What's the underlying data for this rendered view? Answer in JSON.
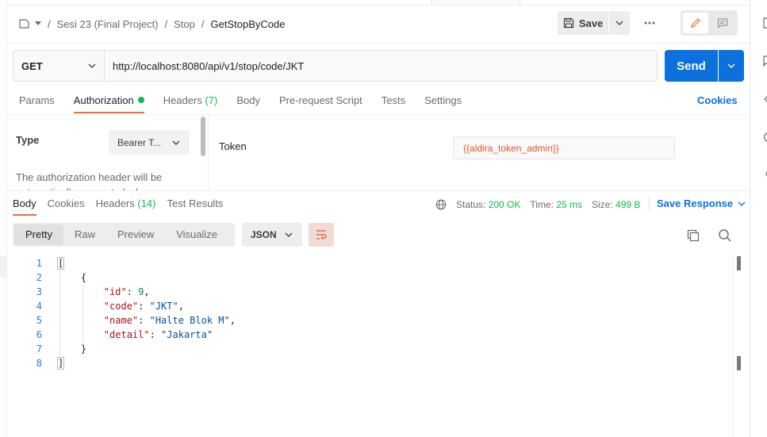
{
  "breadcrumb": {
    "items": [
      "Sesi 23 (Final Project)",
      "Stop"
    ],
    "separator": "/",
    "current": "GetStopByCode"
  },
  "toolbar": {
    "save_label": "Save"
  },
  "request": {
    "method": "GET",
    "url": "http://localhost:8080/api/v1/stop/code/JKT",
    "send_label": "Send"
  },
  "request_tabs": {
    "params": "Params",
    "authorization": "Authorization",
    "headers": "Headers",
    "headers_count": "(7)",
    "body": "Body",
    "pre_request": "Pre-request Script",
    "tests": "Tests",
    "settings": "Settings",
    "cookies": "Cookies"
  },
  "auth": {
    "type_label": "Type",
    "type_value": "Bearer T...",
    "description": "The authorization header will be automatically generated when you",
    "token_label": "Token",
    "token_value": "{{aldira_token_admin}}"
  },
  "response_tabs": {
    "body": "Body",
    "cookies": "Cookies",
    "headers": "Headers",
    "headers_count": "(14)",
    "test_results": "Test Results"
  },
  "response_status": {
    "status_label": "Status:",
    "status_value": "200 OK",
    "time_label": "Time:",
    "time_value": "25 ms",
    "size_label": "Size:",
    "size_value": "499 B",
    "save_response": "Save Response"
  },
  "view": {
    "tabs": [
      "Pretty",
      "Raw",
      "Preview",
      "Visualize"
    ],
    "active": "Pretty",
    "format": "JSON"
  },
  "code": {
    "line_numbers": [
      "1",
      "2",
      "3",
      "4",
      "5",
      "6",
      "7",
      "8"
    ],
    "lines": [
      "[",
      "    {",
      "        \"id\": 9,",
      "        \"code\": \"JKT\",",
      "        \"name\": \"Halte Blok M\",",
      "        \"detail\": \"Jakarta\"",
      "    }",
      "]"
    ]
  },
  "colors": {
    "accent": "#f26b3a",
    "primary": "#0c70dd",
    "success": "#0cbb52",
    "token": "#e4572e"
  }
}
